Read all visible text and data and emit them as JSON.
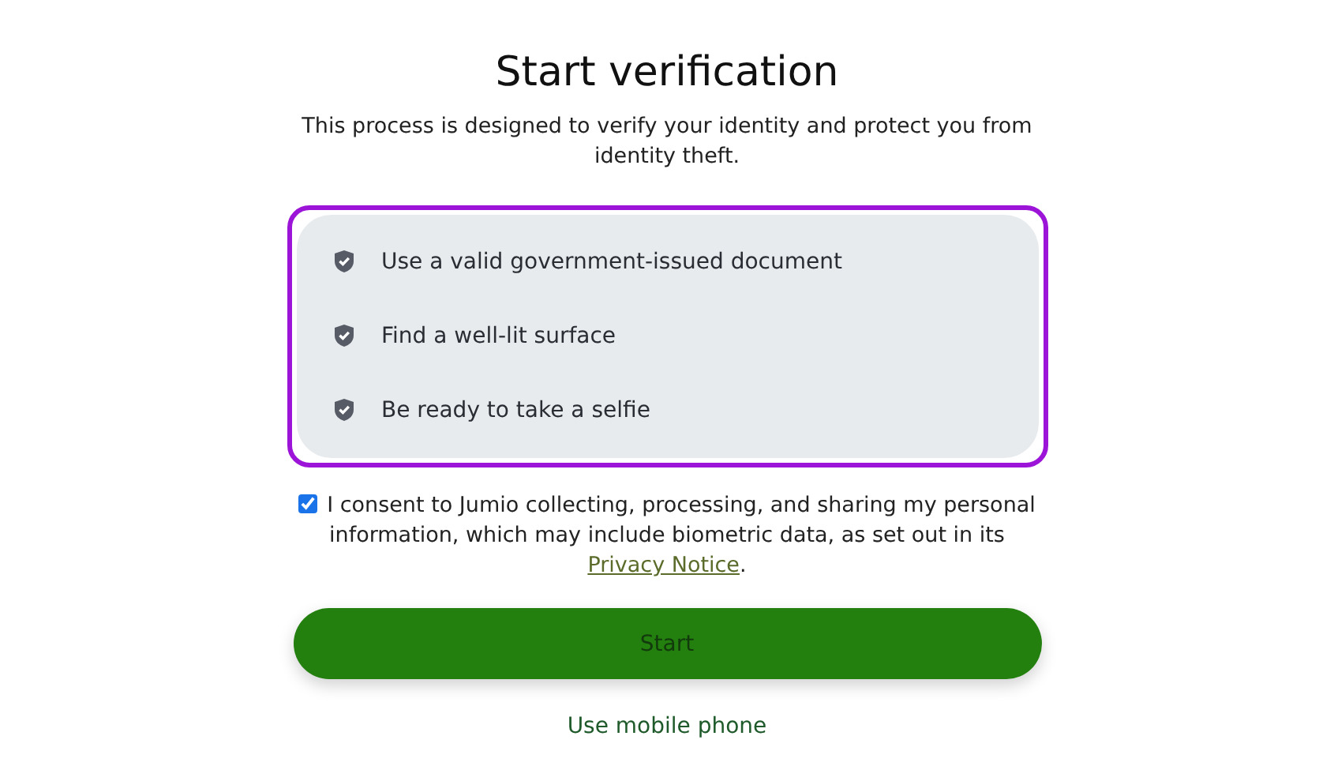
{
  "title": "Start verification",
  "subtitle": "This process is designed to verify your identity and protect you from identity theft.",
  "checklist": {
    "highlighted": true,
    "items": [
      {
        "text": "Use a valid government-issued document"
      },
      {
        "text": "Find a well-lit surface"
      },
      {
        "text": "Be ready to take a selfie"
      }
    ]
  },
  "consent": {
    "checked": true,
    "text": "I consent to Jumio collecting, processing, and sharing my personal information, which may include biometric data, as set out in its ",
    "link": "Privacy Notice",
    "end": "."
  },
  "start_button": "Start",
  "mobile_link": "Use mobile phone"
}
